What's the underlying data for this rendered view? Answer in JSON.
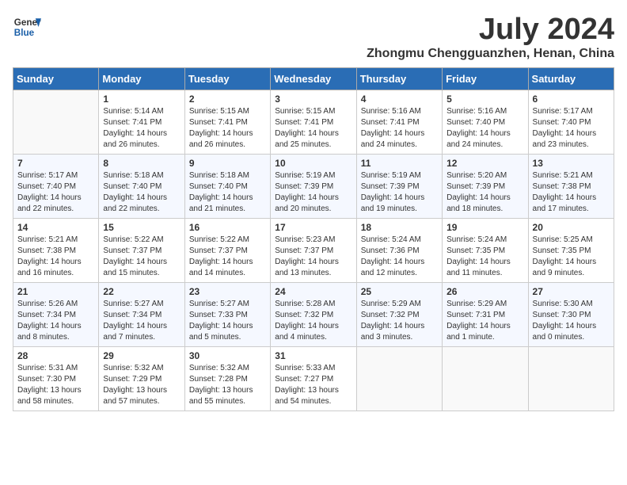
{
  "logo": {
    "line1": "General",
    "line2": "Blue"
  },
  "title": "July 2024",
  "location": "Zhongmu Chengguanzhen, Henan, China",
  "days_of_week": [
    "Sunday",
    "Monday",
    "Tuesday",
    "Wednesday",
    "Thursday",
    "Friday",
    "Saturday"
  ],
  "weeks": [
    [
      {
        "day": "",
        "info": ""
      },
      {
        "day": "1",
        "info": "Sunrise: 5:14 AM\nSunset: 7:41 PM\nDaylight: 14 hours\nand 26 minutes."
      },
      {
        "day": "2",
        "info": "Sunrise: 5:15 AM\nSunset: 7:41 PM\nDaylight: 14 hours\nand 26 minutes."
      },
      {
        "day": "3",
        "info": "Sunrise: 5:15 AM\nSunset: 7:41 PM\nDaylight: 14 hours\nand 25 minutes."
      },
      {
        "day": "4",
        "info": "Sunrise: 5:16 AM\nSunset: 7:41 PM\nDaylight: 14 hours\nand 24 minutes."
      },
      {
        "day": "5",
        "info": "Sunrise: 5:16 AM\nSunset: 7:40 PM\nDaylight: 14 hours\nand 24 minutes."
      },
      {
        "day": "6",
        "info": "Sunrise: 5:17 AM\nSunset: 7:40 PM\nDaylight: 14 hours\nand 23 minutes."
      }
    ],
    [
      {
        "day": "7",
        "info": "Sunrise: 5:17 AM\nSunset: 7:40 PM\nDaylight: 14 hours\nand 22 minutes."
      },
      {
        "day": "8",
        "info": "Sunrise: 5:18 AM\nSunset: 7:40 PM\nDaylight: 14 hours\nand 22 minutes."
      },
      {
        "day": "9",
        "info": "Sunrise: 5:18 AM\nSunset: 7:40 PM\nDaylight: 14 hours\nand 21 minutes."
      },
      {
        "day": "10",
        "info": "Sunrise: 5:19 AM\nSunset: 7:39 PM\nDaylight: 14 hours\nand 20 minutes."
      },
      {
        "day": "11",
        "info": "Sunrise: 5:19 AM\nSunset: 7:39 PM\nDaylight: 14 hours\nand 19 minutes."
      },
      {
        "day": "12",
        "info": "Sunrise: 5:20 AM\nSunset: 7:39 PM\nDaylight: 14 hours\nand 18 minutes."
      },
      {
        "day": "13",
        "info": "Sunrise: 5:21 AM\nSunset: 7:38 PM\nDaylight: 14 hours\nand 17 minutes."
      }
    ],
    [
      {
        "day": "14",
        "info": "Sunrise: 5:21 AM\nSunset: 7:38 PM\nDaylight: 14 hours\nand 16 minutes."
      },
      {
        "day": "15",
        "info": "Sunrise: 5:22 AM\nSunset: 7:37 PM\nDaylight: 14 hours\nand 15 minutes."
      },
      {
        "day": "16",
        "info": "Sunrise: 5:22 AM\nSunset: 7:37 PM\nDaylight: 14 hours\nand 14 minutes."
      },
      {
        "day": "17",
        "info": "Sunrise: 5:23 AM\nSunset: 7:37 PM\nDaylight: 14 hours\nand 13 minutes."
      },
      {
        "day": "18",
        "info": "Sunrise: 5:24 AM\nSunset: 7:36 PM\nDaylight: 14 hours\nand 12 minutes."
      },
      {
        "day": "19",
        "info": "Sunrise: 5:24 AM\nSunset: 7:35 PM\nDaylight: 14 hours\nand 11 minutes."
      },
      {
        "day": "20",
        "info": "Sunrise: 5:25 AM\nSunset: 7:35 PM\nDaylight: 14 hours\nand 9 minutes."
      }
    ],
    [
      {
        "day": "21",
        "info": "Sunrise: 5:26 AM\nSunset: 7:34 PM\nDaylight: 14 hours\nand 8 minutes."
      },
      {
        "day": "22",
        "info": "Sunrise: 5:27 AM\nSunset: 7:34 PM\nDaylight: 14 hours\nand 7 minutes."
      },
      {
        "day": "23",
        "info": "Sunrise: 5:27 AM\nSunset: 7:33 PM\nDaylight: 14 hours\nand 5 minutes."
      },
      {
        "day": "24",
        "info": "Sunrise: 5:28 AM\nSunset: 7:32 PM\nDaylight: 14 hours\nand 4 minutes."
      },
      {
        "day": "25",
        "info": "Sunrise: 5:29 AM\nSunset: 7:32 PM\nDaylight: 14 hours\nand 3 minutes."
      },
      {
        "day": "26",
        "info": "Sunrise: 5:29 AM\nSunset: 7:31 PM\nDaylight: 14 hours\nand 1 minute."
      },
      {
        "day": "27",
        "info": "Sunrise: 5:30 AM\nSunset: 7:30 PM\nDaylight: 14 hours\nand 0 minutes."
      }
    ],
    [
      {
        "day": "28",
        "info": "Sunrise: 5:31 AM\nSunset: 7:30 PM\nDaylight: 13 hours\nand 58 minutes."
      },
      {
        "day": "29",
        "info": "Sunrise: 5:32 AM\nSunset: 7:29 PM\nDaylight: 13 hours\nand 57 minutes."
      },
      {
        "day": "30",
        "info": "Sunrise: 5:32 AM\nSunset: 7:28 PM\nDaylight: 13 hours\nand 55 minutes."
      },
      {
        "day": "31",
        "info": "Sunrise: 5:33 AM\nSunset: 7:27 PM\nDaylight: 13 hours\nand 54 minutes."
      },
      {
        "day": "",
        "info": ""
      },
      {
        "day": "",
        "info": ""
      },
      {
        "day": "",
        "info": ""
      }
    ]
  ]
}
